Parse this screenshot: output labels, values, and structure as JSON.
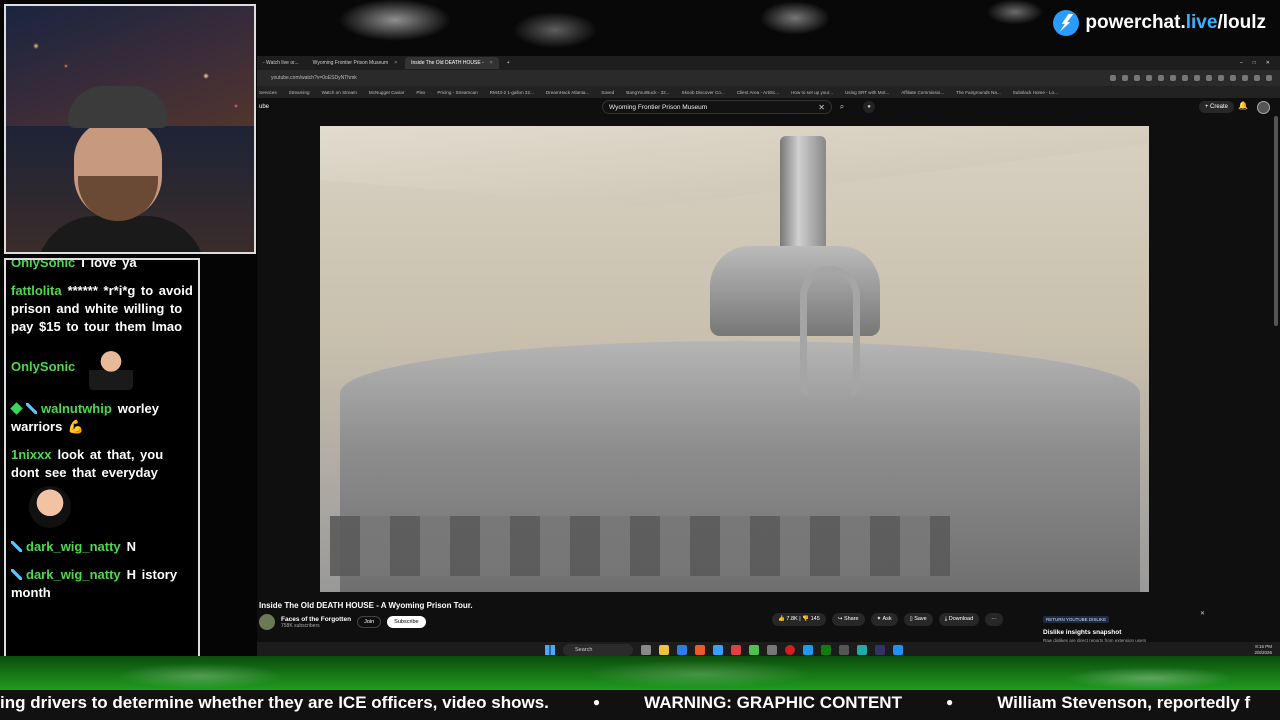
{
  "brand": {
    "prefix": "powerchat.",
    "accent": "live",
    "suffix": "/loulz"
  },
  "chat": {
    "messages": [
      {
        "user": "OnlySonic",
        "text": "I love ya"
      },
      {
        "user": "fattlolita",
        "text": "****** *r*i*g to avoid prison and white willing to pay $15 to tour them lmao"
      },
      {
        "user": "OnlySonic",
        "text": ""
      },
      {
        "user": "walnutwhip",
        "text": "worley warriors 💪"
      },
      {
        "user": "1nixxx",
        "text": "look at that, you dont see that everyday"
      },
      {
        "user": "dark_wig_natty",
        "text": "N"
      },
      {
        "user": "dark_wig_natty",
        "text": "H istory month"
      }
    ]
  },
  "browser": {
    "tabs": [
      {
        "label": "- Watch live or..."
      },
      {
        "label": "Wyoming Frontier Prison Museum"
      },
      {
        "label": "Inside The Old DEATH HOUSE -"
      }
    ],
    "url": "youtube.com/watch?v=0oESDyNThmk",
    "bookmarks": [
      "Services",
      "Streaming",
      "Watch on Stream",
      "McNugget Caviar",
      "Plex",
      "Pricing - Streamcan",
      "RM43-2 1-gallon 32...",
      "DreamHack Atlanta...",
      "Saved",
      "BangYourBuck - 32...",
      "Skoob Discover Co...",
      "Client Area - ArtiSc...",
      "How to set up your...",
      "Using SRT with Mot...",
      "Affiliate Commissio...",
      "The Fairgrounds Na...",
      "Subslack Home - Lo..."
    ],
    "youtube_logo": "ube",
    "search_value": "Wyoming Frontier Prison Museum",
    "create_label": "Create"
  },
  "video": {
    "title": "Inside The Old DEATH HOUSE - A Wyoming Prison Tour.",
    "channel": "Faces of the Forgotten",
    "subscribers": "758K subscribers",
    "join_label": "Join",
    "subscribe_label": "Subscribe",
    "likes": "7.8K",
    "dislikes": "145",
    "share_label": "Share",
    "ask_label": "Ask",
    "save_label": "Save",
    "download_label": "Download"
  },
  "ryd": {
    "tag": "RETURN YOUTUBE DISLIKE",
    "title": "Dislike insights snapshot",
    "subtitle": "Raw dislikes are direct reports from extension users"
  },
  "taskbar": {
    "search_label": "Search",
    "time": "8:16 PM",
    "date": "2/8/2026"
  },
  "ticker": {
    "items": [
      "ing drivers to determine whether they are ICE officers, video shows.",
      "WARNING: GRAPHIC CONTENT",
      "William Stevenson, reportedly f"
    ]
  }
}
